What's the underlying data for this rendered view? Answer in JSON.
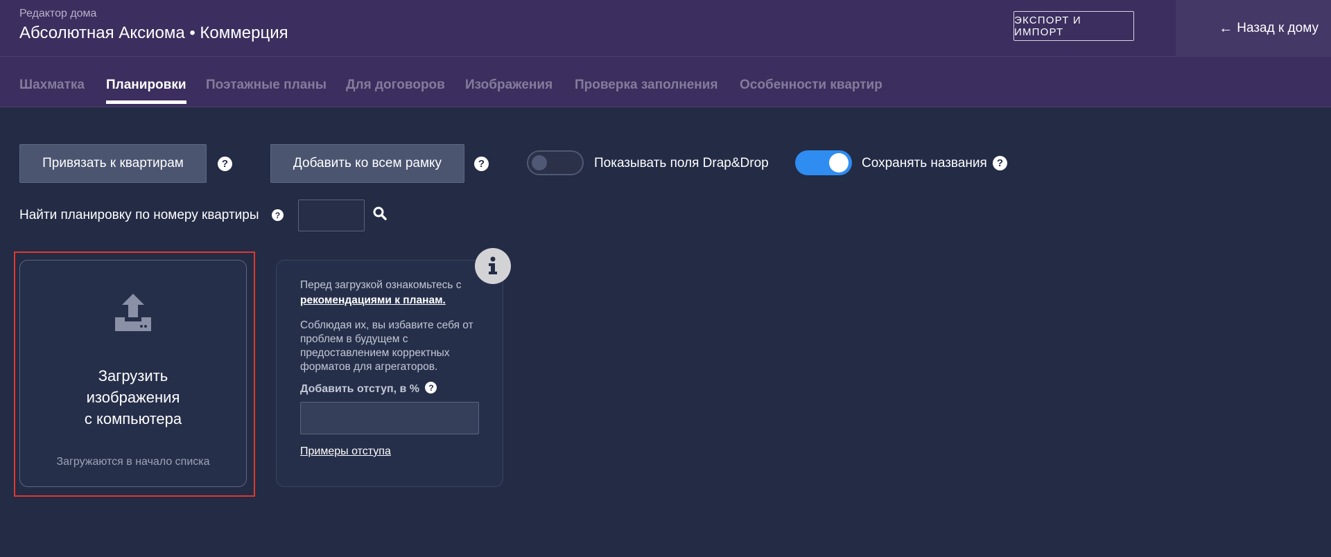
{
  "header": {
    "subtitle": "Редактор дома",
    "title": "Абсолютная Аксиома • Коммерция",
    "export_label": "ЭКСПОРТ И ИМПОРТ",
    "back_arrow": "←",
    "back_label": "Назад к дому"
  },
  "tabs": [
    {
      "label": "Шахматка",
      "active": false
    },
    {
      "label": "Планировки",
      "active": true
    },
    {
      "label": "Поэтажные планы",
      "active": false
    },
    {
      "label": "Для договоров",
      "active": false
    },
    {
      "label": "Изображения",
      "active": false
    },
    {
      "label": "Проверка заполнения",
      "active": false
    },
    {
      "label": "Особенности квартир",
      "active": false
    }
  ],
  "toolbar": {
    "bind_label": "Привязать к квартирам",
    "frame_label": "Добавить ко всем рамку",
    "help_glyph": "?",
    "dragdrop_label": "Показывать поля Drap&Drop",
    "dragdrop_on": false,
    "keep_names_label": "Сохранять названия",
    "keep_names_on": true
  },
  "search": {
    "label": "Найти планировку по номеру квартиры",
    "value": "",
    "icon": "search-icon"
  },
  "upload": {
    "title_lines": [
      "Загрузить",
      "изображения",
      "с компьютера"
    ],
    "hint": "Загружаются в начало списка",
    "icon": "upload-icon"
  },
  "info": {
    "intro": "Перед загрузкой ознакомьтесь с",
    "link": "рекомендациями к планам.",
    "body": "Соблюдая их, вы избавите себя от проблем в будущем с предоставлением корректных форматов для агрегаторов.",
    "indent_label": "Добавить отступ, в %",
    "indent_value": "",
    "examples_link": "Примеры отступа",
    "badge_icon": "info-icon"
  },
  "colors": {
    "background": "#232b45",
    "header": "#3c2e5e",
    "toggle_on": "#2f8cf0",
    "highlight": "#e0382e"
  }
}
